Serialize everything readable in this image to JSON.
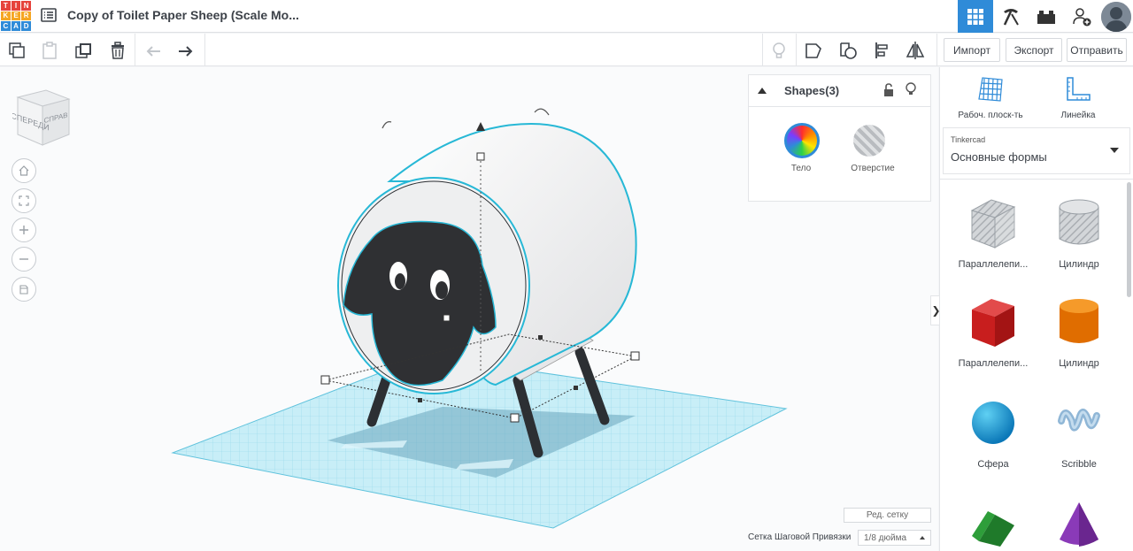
{
  "app": {
    "logo_letters": [
      "T",
      "I",
      "N",
      "K",
      "E",
      "R",
      "C",
      "A",
      "D"
    ],
    "logo_colors": [
      "#e6433c",
      "#e6433c",
      "#e6433c",
      "#f5a623",
      "#f5a623",
      "#f5a623",
      "#2f8bd8",
      "#2f8bd8",
      "#2f8bd8"
    ],
    "document_title": "Copy of Toilet Paper Sheep (Scale Mo..."
  },
  "top_right_icons": [
    "3d-view-grid-icon",
    "pickaxe-icon",
    "bricks-icon",
    "add-user-icon",
    "avatar"
  ],
  "toolbar": {
    "left_tools": [
      "copy-icon",
      "paste-icon",
      "duplicate-icon",
      "delete-icon",
      "undo-icon",
      "redo-icon"
    ],
    "right_tools": [
      "light-icon",
      "note-icon",
      "workplane-shape-icon",
      "align-icon",
      "mirror-icon"
    ],
    "import_label": "Импорт",
    "export_label": "Экспорт",
    "send_label": "Отправить"
  },
  "viewcube": {
    "front": "СПЕРЕДИ",
    "right": "СПРАВ"
  },
  "shapes_panel": {
    "title": "Shapes(3)",
    "solid_label": "Тело",
    "hole_label": "Отверстие"
  },
  "sidebar": {
    "workplane_label": "Рабоч. плоск-ть",
    "ruler_label": "Линейка",
    "library_owner": "Tinkercad",
    "library_name": "Основные формы",
    "shapes": [
      {
        "label": "Параллелепи...",
        "kind": "box-hole"
      },
      {
        "label": "Цилиндр",
        "kind": "cylinder-hole"
      },
      {
        "label": "Параллелепи...",
        "kind": "box-red"
      },
      {
        "label": "Цилиндр",
        "kind": "cylinder-orange"
      },
      {
        "label": "Сфера",
        "kind": "sphere"
      },
      {
        "label": "Scribble",
        "kind": "scribble"
      },
      {
        "label": "",
        "kind": "roof"
      },
      {
        "label": "",
        "kind": "cone"
      }
    ]
  },
  "bottom": {
    "edit_grid": "Ред. сетку",
    "snap_label": "Сетка Шаговой Привязки",
    "snap_value": "1/8 дюйма"
  },
  "colors": {
    "accent": "#2f8bd8",
    "grid": "#7fd0e6",
    "selection": "#27b8d6"
  }
}
